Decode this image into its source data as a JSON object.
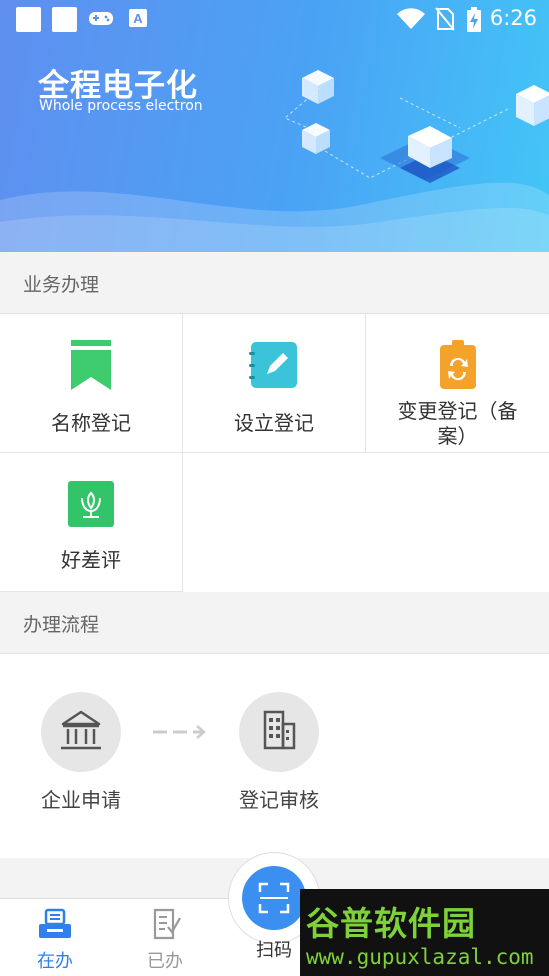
{
  "status_bar": {
    "time": "6:26"
  },
  "banner": {
    "title": "全程电子化",
    "subtitle": "Whole process electron"
  },
  "section_business": {
    "title": "业务办理"
  },
  "services": [
    {
      "label": "名称登记",
      "icon": "bookmark-icon",
      "color": "#3ecb6e"
    },
    {
      "label": "设立登记",
      "icon": "notebook-pen-icon",
      "color": "#3bc3d9"
    },
    {
      "label": "变更登记（备",
      "label2": "案）",
      "icon": "clipboard-refresh-icon",
      "color": "#f5a22a"
    },
    {
      "label": "好差评",
      "icon": "flower-icon",
      "color": "#33c46a"
    }
  ],
  "section_flow": {
    "title": "办理流程"
  },
  "flow_steps": [
    {
      "label": "企业申请",
      "icon": "bank-icon"
    },
    {
      "label": "登记审核",
      "icon": "building-icon"
    }
  ],
  "tabbar": {
    "tabs": [
      {
        "label": "在办",
        "icon": "printer-tray-icon",
        "active": true
      },
      {
        "label": "已办",
        "icon": "document-check-icon",
        "active": false
      }
    ],
    "scan_label": "扫码",
    "active_color": "#2f80ed",
    "inactive_color": "#999999"
  },
  "watermark": {
    "title": "谷普软件园",
    "url": "www.gupuxlazal.com"
  }
}
